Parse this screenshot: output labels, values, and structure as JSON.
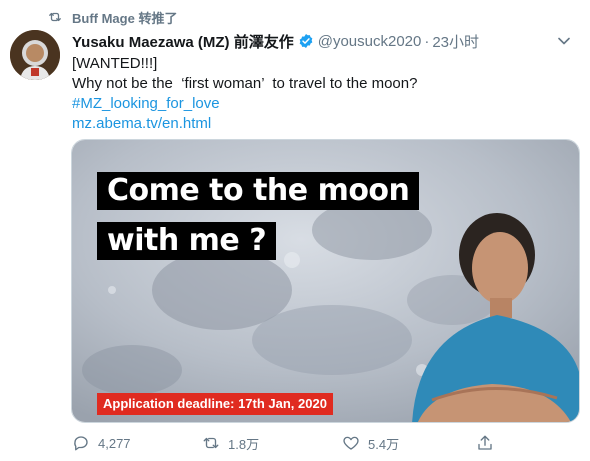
{
  "retweet": {
    "icon": "retweet-icon",
    "label": "Buff Mage 转推了"
  },
  "author": {
    "display_name": "Yusaku Maezawa (MZ) 前澤友作",
    "handle": "@yousuck2020",
    "separator": "·",
    "time": "23小时",
    "verified": true
  },
  "tweet": {
    "lines": [
      "[WANTED!!!]",
      "Why not be the  ‘first woman’  to travel to the moon?"
    ],
    "hashtag": "#MZ_looking_for_love",
    "url": "mz.abema.tv/en.html"
  },
  "media": {
    "headline_1": "Come to the moon",
    "headline_2": "with me ?",
    "deadline": "Application deadline: 17th Jan, 2020"
  },
  "actions": {
    "reply_count": "4,277",
    "retweet_count": "1.8万",
    "like_count": "5.4万"
  },
  "colors": {
    "link": "#1b95e0",
    "muted": "#657786",
    "verified": "#1da1f2",
    "deadline_bg": "#e02b20"
  }
}
